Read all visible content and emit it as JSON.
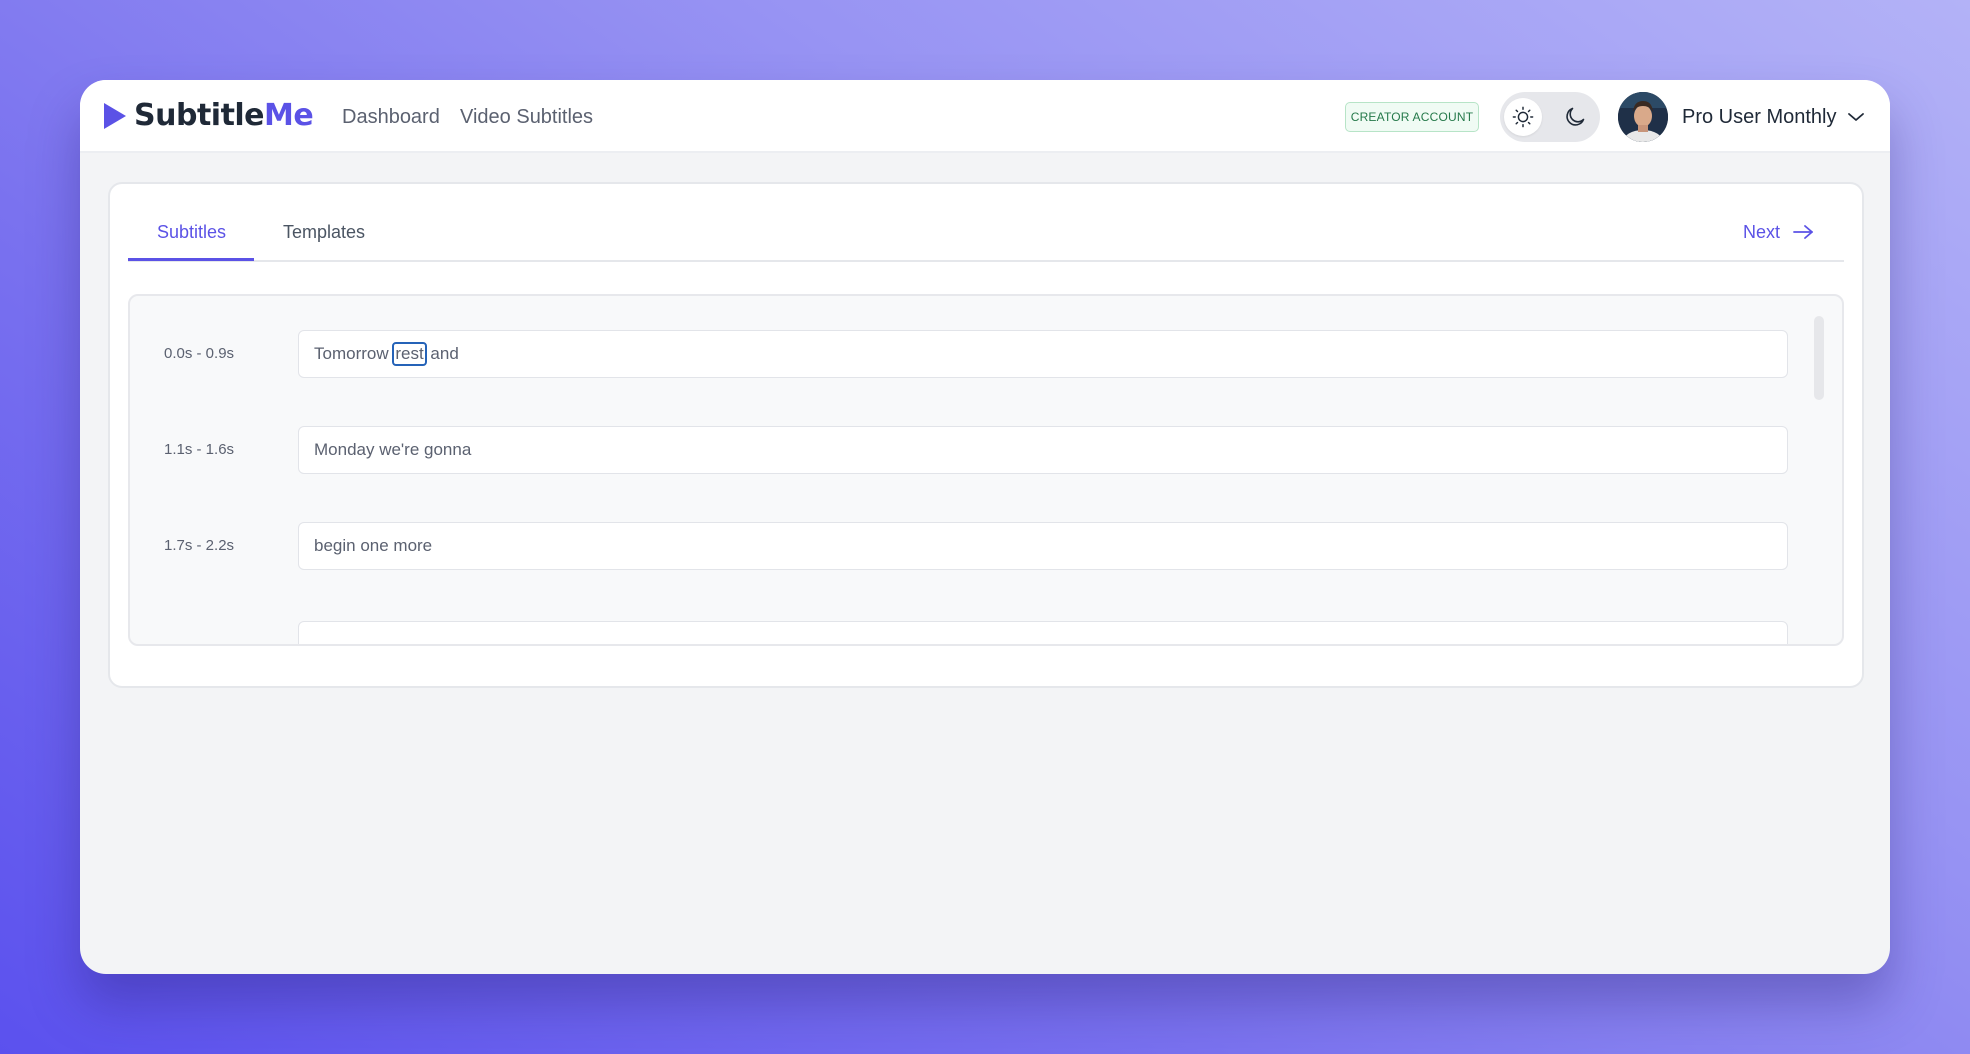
{
  "app": {
    "logo_part1": "Subtitle",
    "logo_part2": "Me"
  },
  "nav": {
    "links": [
      {
        "label": "Dashboard"
      },
      {
        "label": "Video Subtitles"
      }
    ]
  },
  "header": {
    "badge": "CREATOR ACCOUNT",
    "user_name": "Pro User Monthly",
    "theme_mode": "light"
  },
  "tabs": [
    {
      "label": "Subtitles",
      "active": true
    },
    {
      "label": "Templates",
      "active": false
    }
  ],
  "next_label": "Next",
  "subtitles": [
    {
      "time": "0.0s - 0.9s",
      "text_before": "Tomorrow ",
      "selected_word": "rest",
      "text_after": " and"
    },
    {
      "time": "1.1s - 1.6s",
      "text": "Monday we're gonna"
    },
    {
      "time": "1.7s - 2.2s",
      "text": "begin one more"
    }
  ],
  "colors": {
    "accent": "#5b52e6",
    "badge_text": "#25794a",
    "selection_outline": "#2563b8"
  }
}
